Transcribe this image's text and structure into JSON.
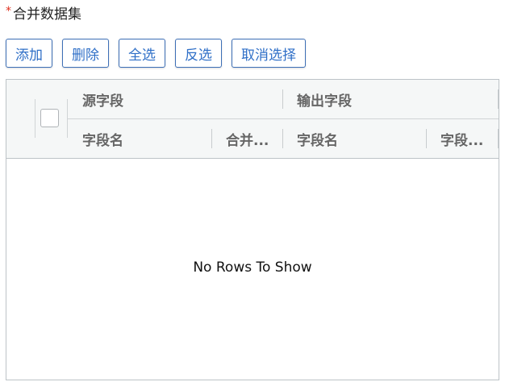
{
  "form": {
    "required_mark": "*",
    "label": "合并数据集"
  },
  "toolbar": {
    "add_label": "添加",
    "delete_label": "删除",
    "select_all_label": "全选",
    "invert_label": "反选",
    "deselect_label": "取消选择"
  },
  "grid": {
    "groups": {
      "source": "源字段",
      "output": "输出字段"
    },
    "columns": {
      "source_field_name": "字段名",
      "merge": "合并...",
      "output_field_name": "字段名",
      "output_field_other": "字段..."
    },
    "empty_message": "No Rows To Show"
  },
  "colors": {
    "accent": "#2f6fc7",
    "required": "#e0301e",
    "header_bg": "#f5f7f7",
    "border": "#bdc3c7"
  }
}
